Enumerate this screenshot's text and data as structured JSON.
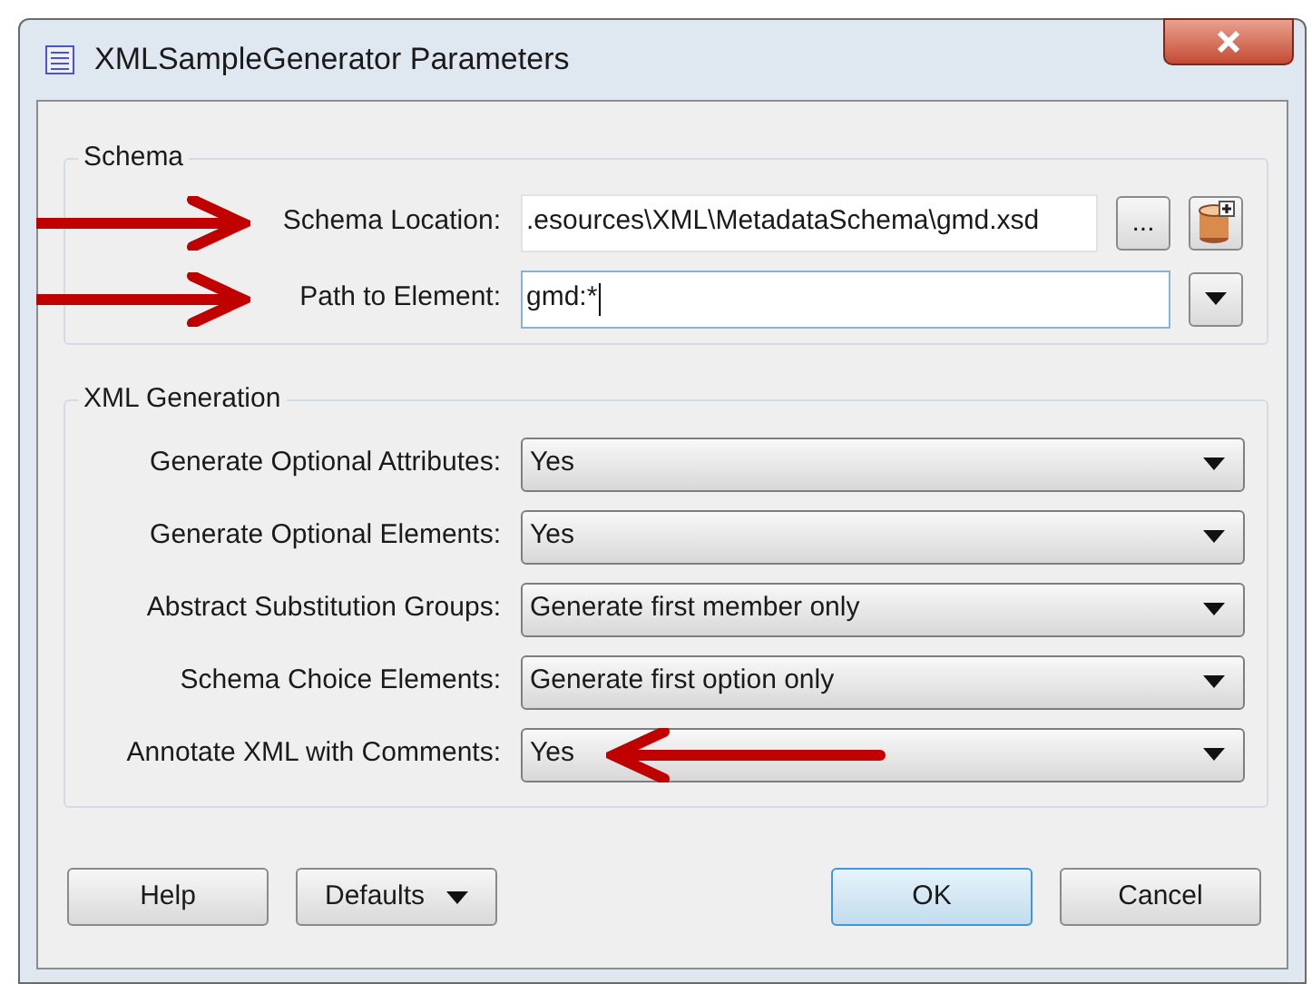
{
  "window": {
    "title": "XMLSampleGenerator Parameters"
  },
  "schema_group": {
    "title": "Schema",
    "rows": [
      {
        "kind": "file",
        "label": "Schema Location:",
        "value": ".esources\\XML\\MetadataSchema\\gmd.xsd",
        "browse_button": "...",
        "annotation_arrow": true
      },
      {
        "kind": "path",
        "label": "Path to Element:",
        "value": "gmd:*",
        "annotation_arrow": true
      }
    ]
  },
  "generation_group": {
    "title": "XML Generation",
    "rows": [
      {
        "label": "Generate Optional Attributes:",
        "value": "Yes",
        "annotation_arrow": false
      },
      {
        "label": "Generate Optional Elements:",
        "value": "Yes",
        "annotation_arrow": false
      },
      {
        "label": "Abstract Substitution Groups:",
        "value": "Generate first member only",
        "annotation_arrow": false
      },
      {
        "label": "Schema Choice Elements:",
        "value": "Generate first option only",
        "annotation_arrow": false
      },
      {
        "label": "Annotate XML with Comments:",
        "value": "Yes",
        "annotation_arrow": true
      }
    ]
  },
  "buttons": [
    {
      "label": "Help",
      "kind": "plain",
      "default": false
    },
    {
      "label": "Defaults",
      "kind": "menu",
      "default": false
    },
    {
      "label": "OK",
      "kind": "plain",
      "default": true
    },
    {
      "label": "Cancel",
      "kind": "plain",
      "default": false
    }
  ]
}
